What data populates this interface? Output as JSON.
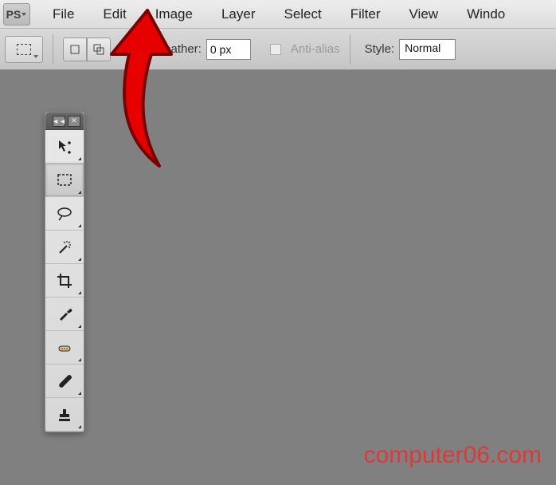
{
  "logo": "PS",
  "menu": {
    "file": "File",
    "edit": "Edit",
    "image": "Image",
    "layer": "Layer",
    "select": "Select",
    "filter": "Filter",
    "view": "View",
    "window": "Windo"
  },
  "options": {
    "feather_label": "Feather:",
    "feather_value": "0 px",
    "antialias_label": "Anti-alias",
    "style_label": "Style:",
    "style_value": "Normal"
  },
  "tools": [
    {
      "name": "move-tool",
      "icon": "move"
    },
    {
      "name": "marquee-tool",
      "icon": "marquee",
      "selected": true
    },
    {
      "name": "lasso-tool",
      "icon": "lasso"
    },
    {
      "name": "wand-tool",
      "icon": "wand"
    },
    {
      "name": "crop-tool",
      "icon": "crop"
    },
    {
      "name": "eyedropper-tool",
      "icon": "eyedropper"
    },
    {
      "name": "healing-tool",
      "icon": "healing"
    },
    {
      "name": "brush-tool",
      "icon": "brush"
    },
    {
      "name": "stamp-tool",
      "icon": "stamp"
    }
  ],
  "palette": {
    "collapse": "◄◄",
    "close": "✕"
  },
  "watermark": "computer06.com"
}
